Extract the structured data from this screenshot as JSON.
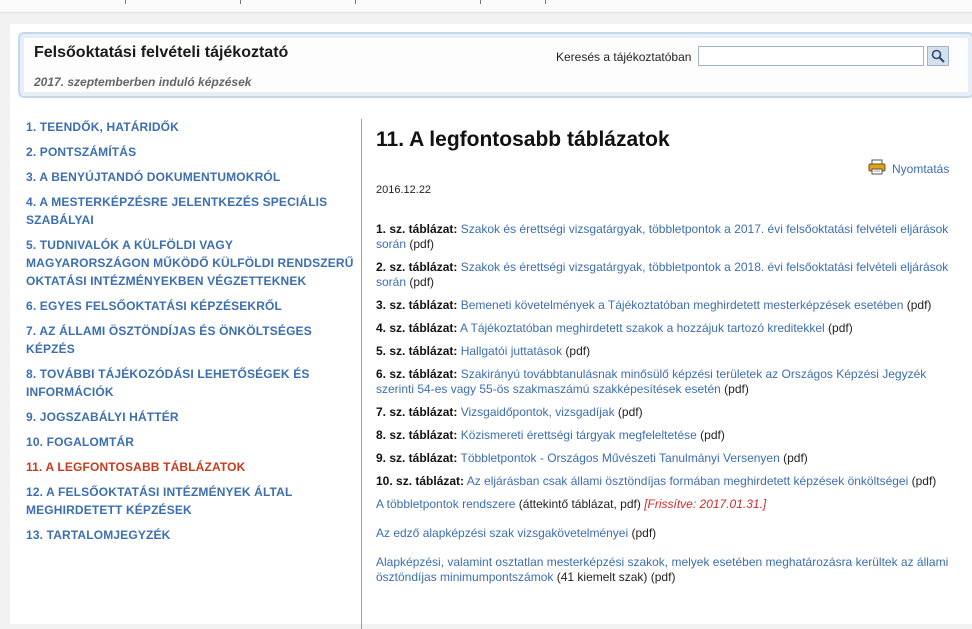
{
  "header": {
    "title": "Felsőoktatási felvételi tájékoztató",
    "subtitle": "2017. szeptemberben induló képzések",
    "search_label": "Keresés a tájékoztatóban",
    "search_value": "",
    "search_placeholder": ""
  },
  "sidebar": {
    "items": [
      {
        "label": "1. TEENDŐK, HATÁRIDŐK"
      },
      {
        "label": "2. PONTSZÁMÍTÁS"
      },
      {
        "label": "3. A BENYÚJTANDÓ DOKUMENTUMOKRÓL"
      },
      {
        "label": "4. A MESTERKÉPZÉSRE JELENTKEZÉS SPECIÁLIS SZABÁLYAI"
      },
      {
        "label": "5. TUDNIVALÓK A KÜLFÖLDI VAGY MAGYARORSZÁGON MŰKÖDŐ KÜLFÖLDI RENDSZERŰ OKTATÁSI INTÉZMÉNYEKBEN VÉGZETTEKNEK"
      },
      {
        "label": "6. EGYES FELSŐOKTATÁSI KÉPZÉSEKRŐL"
      },
      {
        "label": "7. AZ ÁLLAMI ÖSZTÖNDÍJAS ÉS ÖNKÖLTSÉGES KÉPZÉS"
      },
      {
        "label": "8. TOVÁBBI TÁJÉKOZÓDÁSI LEHETŐSÉGEK ÉS INFORMÁCIÓK"
      },
      {
        "label": "9. JOGSZABÁLYI HÁTTÉR"
      },
      {
        "label": "10. FOGALOMTÁR"
      },
      {
        "label": "11. A LEGFONTOSABB TÁBLÁZATOK",
        "active": true
      },
      {
        "label": "12. A FELSŐOKTATÁSI INTÉZMÉNYEK ÁLTAL MEGHIRDETETT KÉPZÉSEK"
      },
      {
        "label": "13. TARTALOMJEGYZÉK"
      }
    ]
  },
  "main": {
    "heading": "11. A legfontosabb táblázatok",
    "print_label": "Nyomtatás",
    "print_icon": "printer-icon",
    "date": "2016.12.22",
    "tables": [
      {
        "label": "1. sz. táblázat:",
        "link": "Szakok és érettségi vizsgatárgyak, többletpontok a 2017. évi felsőoktatási felvételi eljárások során",
        "suffix": " (pdf)"
      },
      {
        "label": "2. sz. táblázat:",
        "link": "Szakok és érettségi vizsgatárgyak, többletpontok a 2018. évi felsőoktatási felvételi eljárások során",
        "suffix": " (pdf)"
      },
      {
        "label": "3. sz. táblázat:",
        "link": "Bemeneti követelmények a Tájékoztatóban meghirdetett mesterképzések esetében",
        "suffix": " (pdf)"
      },
      {
        "label": "4. sz. táblázat:",
        "link": "A Tájékoztatóban meghirdetett szakok a hozzájuk tartozó kreditekkel",
        "suffix": " (pdf)"
      },
      {
        "label": "5. sz. táblázat:",
        "link": "Hallgatói juttatások",
        "suffix": " (pdf)"
      },
      {
        "label": "6. sz. táblázat:",
        "link": "Szakirányú továbbtanulásnak minősülő képzési területek az Országos Képzési Jegyzék szerinti 54-es vagy 55-ös szakmaszámú szakképesítések esetén",
        "suffix": " (pdf)"
      },
      {
        "label": "7. sz. táblázat:",
        "link": "Vizsgaidőpontok, vizsgadíjak",
        "suffix": " (pdf)"
      },
      {
        "label": "8. sz. táblázat:",
        "link": "Közismereti érettségi tárgyak megfeleltetése",
        "suffix": " (pdf)"
      },
      {
        "label": "9. sz. táblázat:",
        "link": "Többletpontok - Országos Művészeti Tanulmányi Versenyen",
        "suffix": " (pdf)"
      },
      {
        "label": "10. sz. táblázat:",
        "link": "Az eljárásban csak állami ösztöndíjas formában meghirdetett képzések önköltségei",
        "suffix": " (pdf)"
      }
    ],
    "extras": [
      {
        "link": "A többletpontok rendszere",
        "suffix": " (áttekintő táblázat, pdf) ",
        "note": "[Frissítve: 2017.01.31.]"
      },
      {
        "link": "Az edző alapképzési szak vizsgakövetelményei",
        "suffix": " (pdf)",
        "note": ""
      },
      {
        "link": "Alapképzési, valamint osztatlan mesterképzési szakok, melyek esetében meghatározásra kerültek az állami ösztöndíjas minimumpontszámok",
        "suffix": " (41 kiemelt szak) (pdf)",
        "note": ""
      }
    ]
  },
  "colors": {
    "link": "#3c6eb0",
    "active": "#c93a1e",
    "header_border": "#c5d8ea",
    "note": "#d12a2a"
  }
}
